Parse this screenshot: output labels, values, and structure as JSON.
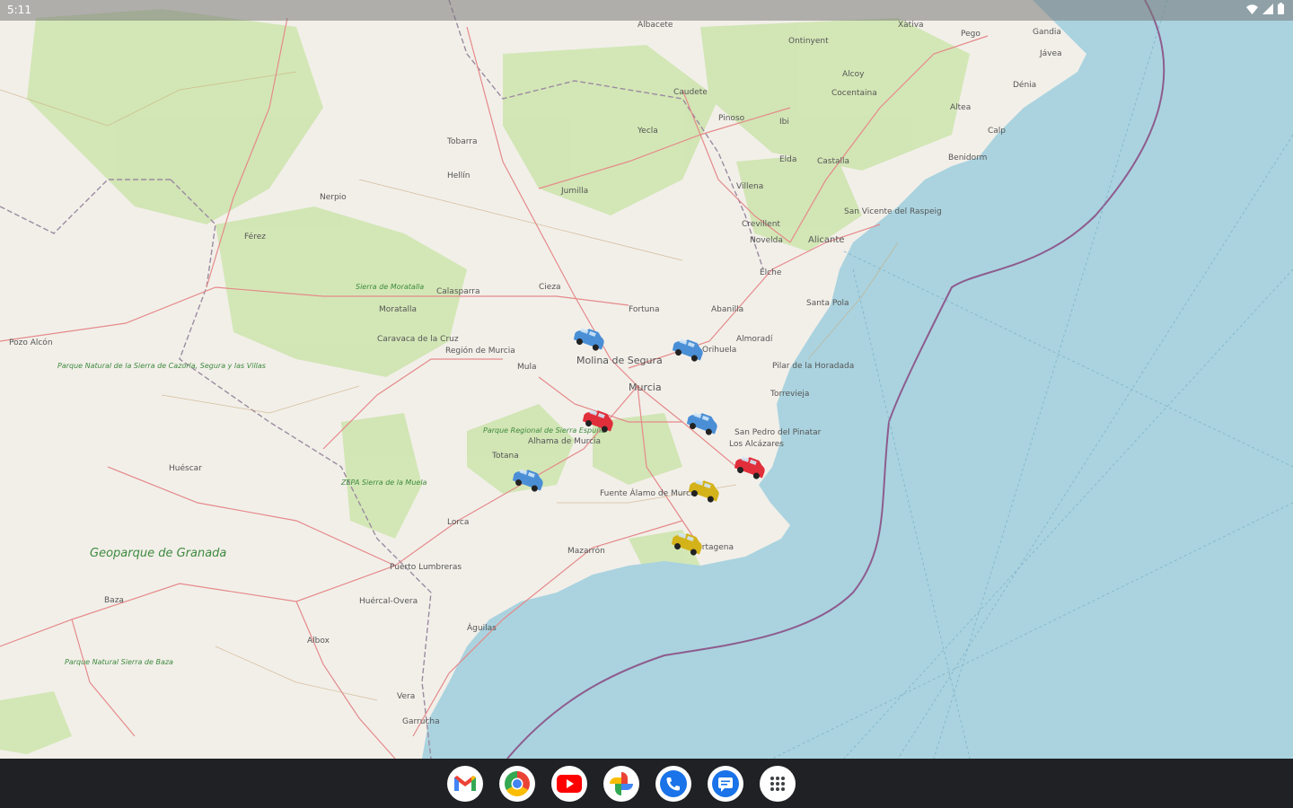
{
  "status_bar": {
    "time": "5:11"
  },
  "map": {
    "places": [
      {
        "name": "Albacete"
      },
      {
        "name": "Caudete"
      },
      {
        "name": "Yecla"
      },
      {
        "name": "Tobarra"
      },
      {
        "name": "Hellín"
      },
      {
        "name": "Jumilla"
      },
      {
        "name": "Calasparra"
      },
      {
        "name": "Cieza"
      },
      {
        "name": "Fortuna"
      },
      {
        "name": "Abanilla"
      },
      {
        "name": "Moratalla"
      },
      {
        "name": "Caravaca de la Cruz"
      },
      {
        "name": "Región de Murcia"
      },
      {
        "name": "Mula"
      },
      {
        "name": "Molina de Segura"
      },
      {
        "name": "Orihuela"
      },
      {
        "name": "Murcia"
      },
      {
        "name": "Torrevieja"
      },
      {
        "name": "Alhama de Murcia"
      },
      {
        "name": "Totana"
      },
      {
        "name": "Lorca"
      },
      {
        "name": "Fuente Álamo de Murcia"
      },
      {
        "name": "Mazarrón"
      },
      {
        "name": "Cartagena"
      },
      {
        "name": "Águilas"
      },
      {
        "name": "Puerto Lumbreras"
      },
      {
        "name": "Huércal-Overa"
      },
      {
        "name": "Vera"
      },
      {
        "name": "Garrucha"
      },
      {
        "name": "Baza"
      },
      {
        "name": "Albox"
      },
      {
        "name": "Huéscar"
      },
      {
        "name": "Pozo Alcón"
      },
      {
        "name": "Elche"
      },
      {
        "name": "Alicante"
      },
      {
        "name": "Elda"
      },
      {
        "name": "Villena"
      },
      {
        "name": "Alcoy"
      },
      {
        "name": "Benidorm"
      },
      {
        "name": "Santa Pola"
      },
      {
        "name": "Crevillent"
      },
      {
        "name": "Novelda"
      },
      {
        "name": "San Vicente del Raspeig"
      },
      {
        "name": "Dénia"
      },
      {
        "name": "Jávea"
      },
      {
        "name": "Calp"
      },
      {
        "name": "Altea"
      },
      {
        "name": "Gandia"
      },
      {
        "name": "Ontinyent"
      },
      {
        "name": "Xàtiva"
      },
      {
        "name": "Pego"
      },
      {
        "name": "Cocentaina"
      },
      {
        "name": "Ibi"
      },
      {
        "name": "Castalla"
      },
      {
        "name": "Pinoso"
      },
      {
        "name": "Almoradí"
      },
      {
        "name": "San Pedro del Pinatar"
      },
      {
        "name": "Los Alcázares"
      },
      {
        "name": "Pilar de la Horadada"
      },
      {
        "name": "Férez"
      },
      {
        "name": "Nerpio"
      }
    ],
    "parks": [
      {
        "name": "Parque Natural de la Sierra de Cazorla, Segura y las Villas"
      },
      {
        "name": "Geoparque de Granada"
      },
      {
        "name": "Parque Natural Sierra de Baza"
      },
      {
        "name": "Parque Regional de Sierra Espuña"
      },
      {
        "name": "Sierra de Moratalla"
      },
      {
        "name": "ZEPA Sierra de la Muela"
      }
    ],
    "vehicles": [
      {
        "name": "car-blue-1",
        "color": "#4a8fd6"
      },
      {
        "name": "car-blue-2",
        "color": "#4a8fd6"
      },
      {
        "name": "car-red-1",
        "color": "#e02e3a"
      },
      {
        "name": "car-blue-3",
        "color": "#4a8fd6"
      },
      {
        "name": "car-red-2",
        "color": "#e02e3a"
      },
      {
        "name": "car-blue-4",
        "color": "#4a8fd6"
      },
      {
        "name": "car-yellow-1",
        "color": "#d4b21a"
      },
      {
        "name": "car-yellow-2",
        "color": "#d4b21a"
      }
    ],
    "colors": {
      "land": "#f2efe9",
      "sea": "#aad3df",
      "forest": "#cfe5b0",
      "road": "#e58a8a"
    }
  },
  "dock": {
    "apps": [
      {
        "name": "Gmail",
        "icon": "gmail-icon"
      },
      {
        "name": "Chrome",
        "icon": "chrome-icon"
      },
      {
        "name": "YouTube",
        "icon": "youtube-icon"
      },
      {
        "name": "Photos",
        "icon": "photos-icon"
      },
      {
        "name": "Phone",
        "icon": "phone-icon"
      },
      {
        "name": "Messages",
        "icon": "messages-icon"
      },
      {
        "name": "All apps",
        "icon": "app-drawer-icon"
      }
    ]
  }
}
